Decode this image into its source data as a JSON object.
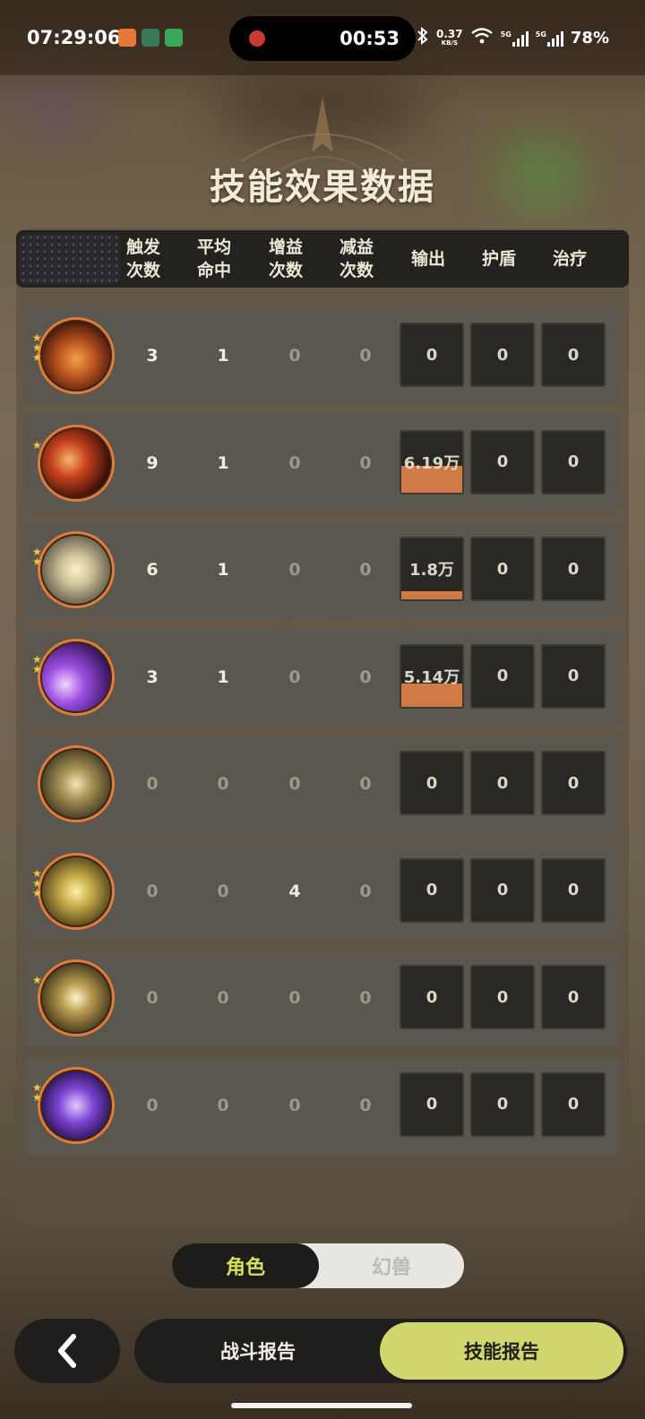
{
  "status_bar": {
    "time": "07:29:06",
    "recording_time": "00:53",
    "net_speed": "0.37",
    "net_unit": "KB/S",
    "net1": "5G",
    "net2": "5G",
    "battery": "78%"
  },
  "title": "技能效果数据",
  "columns": [
    {
      "line1": "触发",
      "line2": "次数"
    },
    {
      "line1": "平均",
      "line2": "命中"
    },
    {
      "line1": "增益",
      "line2": "次数"
    },
    {
      "line1": "减益",
      "line2": "次数"
    },
    {
      "line1": "输出",
      "line2": ""
    },
    {
      "line1": "护盾",
      "line2": ""
    },
    {
      "line1": "治疗",
      "line2": ""
    }
  ],
  "rows": [
    {
      "icon": "fire-swirl-skill-icon",
      "stars": 3,
      "trigger": "3",
      "avg_hit": "1",
      "buff": "0",
      "debuff": "0",
      "output": "0",
      "output_fill": 0,
      "shield": "0",
      "heal": "0"
    },
    {
      "icon": "flame-slash-skill-icon",
      "stars": 1,
      "trigger": "9",
      "avg_hit": "1",
      "buff": "0",
      "debuff": "0",
      "output": "6.19万",
      "output_fill": 0.44,
      "shield": "0",
      "heal": "0"
    },
    {
      "icon": "lightning-strike-skill-icon",
      "stars": 2,
      "trigger": "6",
      "avg_hit": "1",
      "buff": "0",
      "debuff": "0",
      "output": "1.8万",
      "output_fill": 0.13,
      "shield": "0",
      "heal": "0"
    },
    {
      "icon": "purple-vortex-skill-icon",
      "stars": 2,
      "trigger": "3",
      "avg_hit": "1",
      "buff": "0",
      "debuff": "0",
      "output": "5.14万",
      "output_fill": 0.37,
      "shield": "0",
      "heal": "0"
    },
    {
      "icon": "eye-skill-icon",
      "stars": 0,
      "trigger": "0",
      "avg_hit": "0",
      "buff": "0",
      "debuff": "0",
      "output": "0",
      "output_fill": 0,
      "shield": "0",
      "heal": "0"
    },
    {
      "icon": "shadow-figure-skill-icon",
      "stars": 3,
      "trigger": "0",
      "avg_hit": "0",
      "buff": "4",
      "debuff": "0",
      "output": "0",
      "output_fill": 0,
      "shield": "0",
      "heal": "0"
    },
    {
      "icon": "crosshair-skill-icon",
      "stars": 1,
      "trigger": "0",
      "avg_hit": "0",
      "buff": "0",
      "debuff": "0",
      "output": "0",
      "output_fill": 0,
      "shield": "0",
      "heal": "0"
    },
    {
      "icon": "purple-orb-skill-icon",
      "stars": 2,
      "trigger": "0",
      "avg_hit": "0",
      "buff": "0",
      "debuff": "0",
      "output": "0",
      "output_fill": 0,
      "shield": "0",
      "heal": "0"
    }
  ],
  "toggle": {
    "active": "角色",
    "inactive": "幻兽"
  },
  "bottom": {
    "battle_report": "战斗报告",
    "skill_report": "技能报告"
  },
  "colors": {
    "accent": "#d2d66e",
    "bar": "#d27a45",
    "ring": "#e07c3a"
  }
}
